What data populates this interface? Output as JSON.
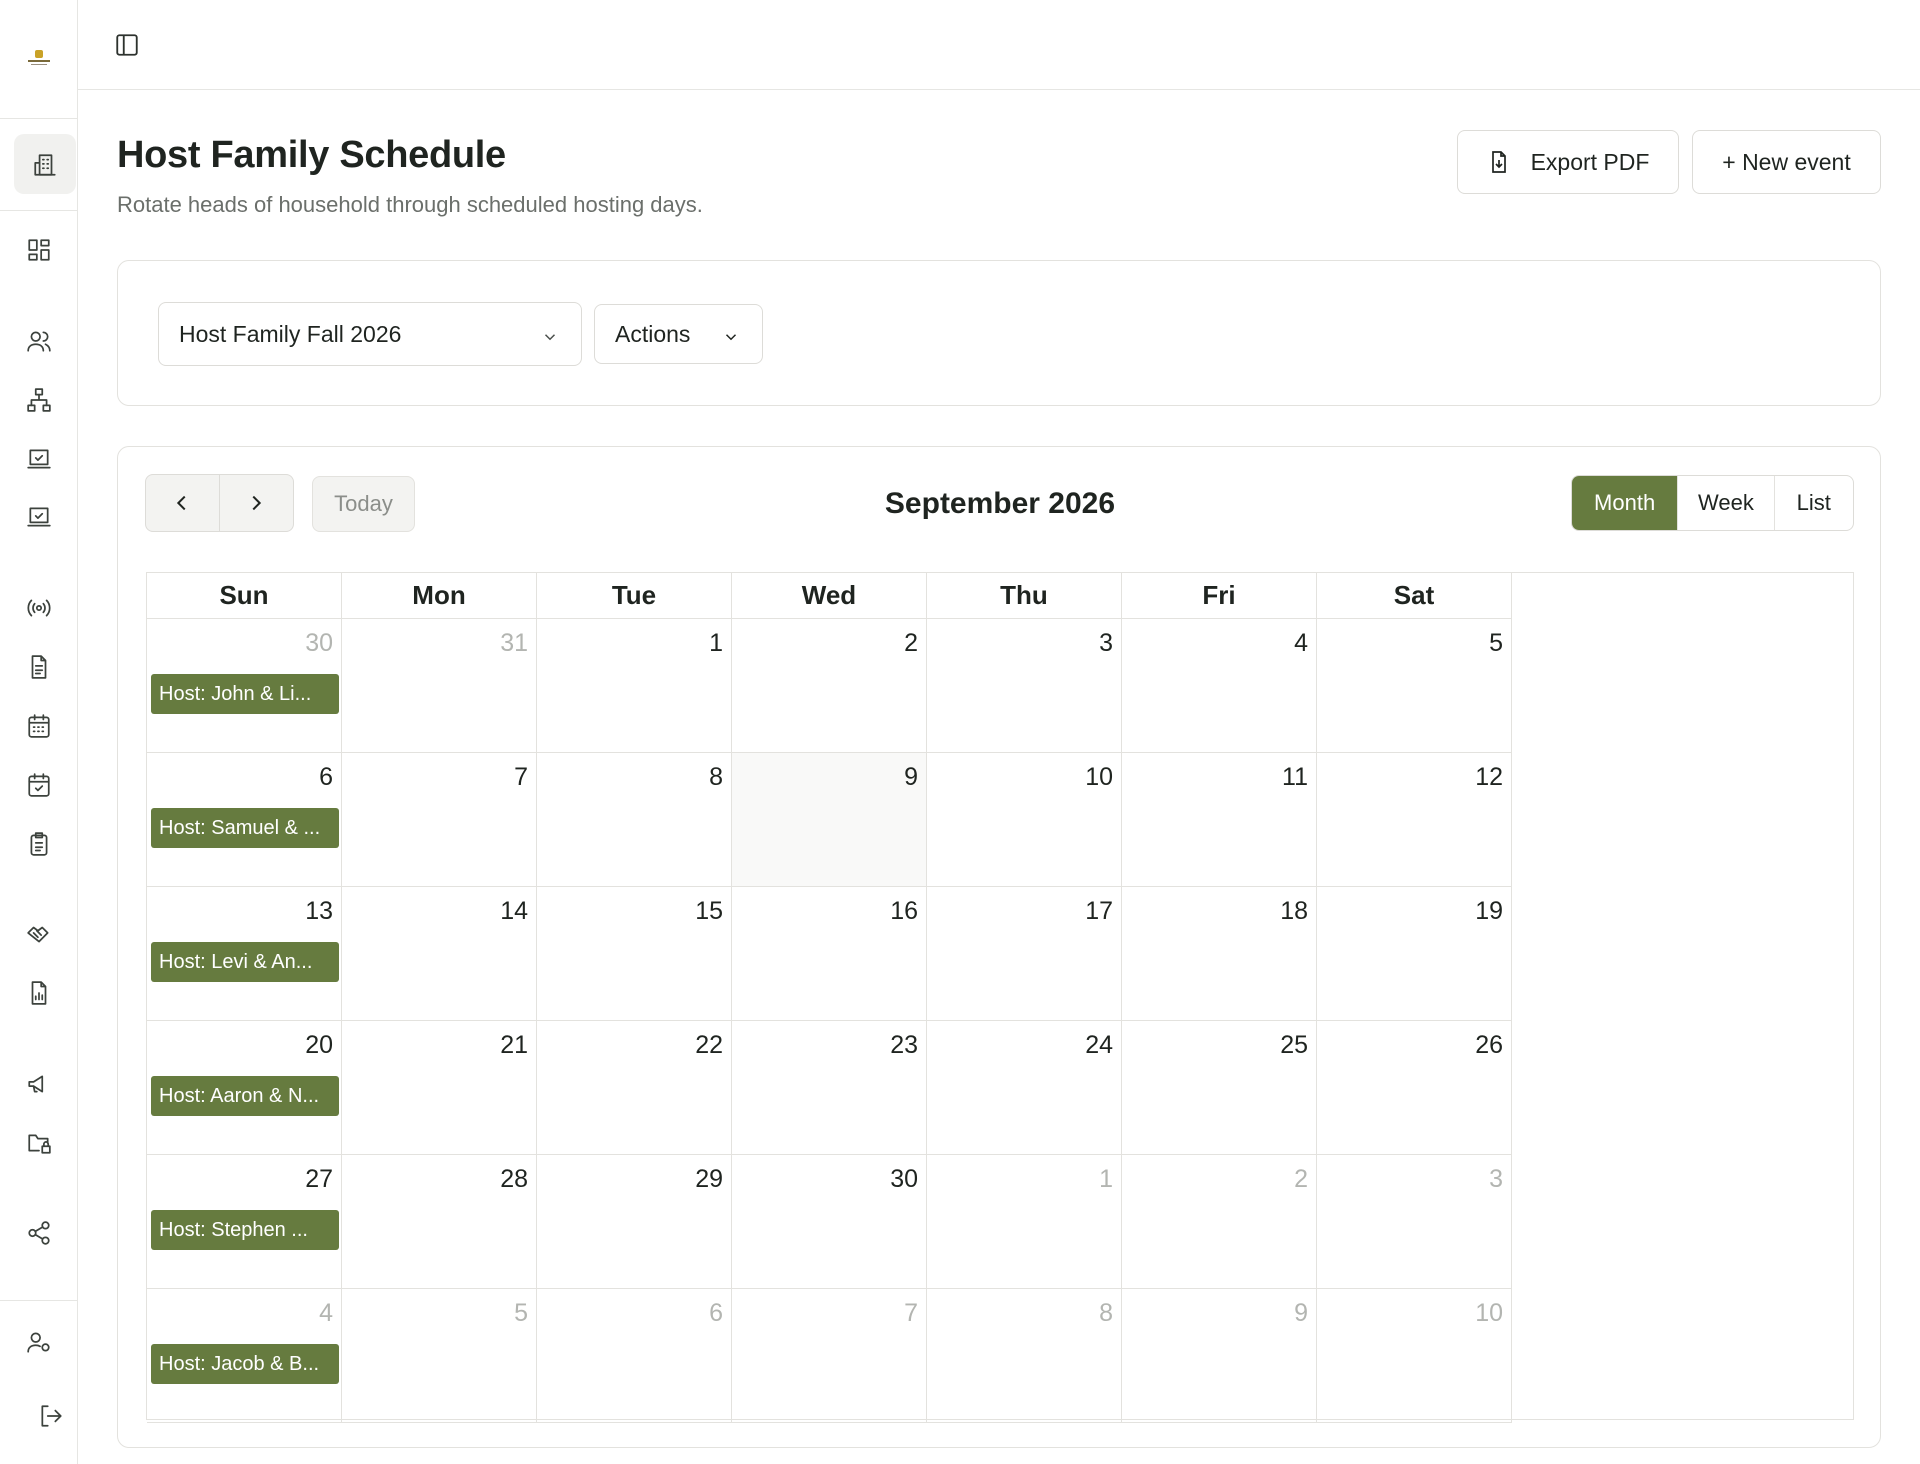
{
  "sidebar": {
    "icons": [
      "building-icon",
      "dashboard-icon",
      "users-icon",
      "org-chart-icon",
      "checkbox-icon",
      "checkbox-icon",
      "broadcast-icon",
      "document-icon",
      "calendar-icon",
      "calendar-check-icon",
      "clipboard-icon",
      "handshake-icon",
      "report-icon",
      "megaphone-icon",
      "folder-lock-icon",
      "share-icon",
      "user-settings-icon",
      "logout-icon"
    ]
  },
  "header": {
    "title": "Host Family Schedule",
    "subtitle": "Rotate heads of household through scheduled hosting days.",
    "export_label": "Export PDF",
    "new_event_label": "+ New event"
  },
  "filters": {
    "schedule_select": "Host Family Fall 2026",
    "actions_label": "Actions"
  },
  "calendar": {
    "title": "September 2026",
    "today_label": "Today",
    "views": [
      {
        "label": "Month",
        "active": true
      },
      {
        "label": "Week",
        "active": false
      },
      {
        "label": "List",
        "active": false
      }
    ],
    "days_of_week": [
      "Sun",
      "Mon",
      "Tue",
      "Wed",
      "Thu",
      "Fri",
      "Sat"
    ],
    "weeks": [
      [
        {
          "num": "30",
          "other": true,
          "event": "Host: John & Li..."
        },
        {
          "num": "31",
          "other": true
        },
        {
          "num": "1"
        },
        {
          "num": "2"
        },
        {
          "num": "3"
        },
        {
          "num": "4"
        },
        {
          "num": "5"
        }
      ],
      [
        {
          "num": "6",
          "event": "Host: Samuel & ..."
        },
        {
          "num": "7"
        },
        {
          "num": "8"
        },
        {
          "num": "9",
          "today": true
        },
        {
          "num": "10"
        },
        {
          "num": "11"
        },
        {
          "num": "12"
        }
      ],
      [
        {
          "num": "13",
          "event": "Host: Levi & An..."
        },
        {
          "num": "14"
        },
        {
          "num": "15"
        },
        {
          "num": "16"
        },
        {
          "num": "17"
        },
        {
          "num": "18"
        },
        {
          "num": "19"
        }
      ],
      [
        {
          "num": "20",
          "event": "Host: Aaron & N..."
        },
        {
          "num": "21"
        },
        {
          "num": "22"
        },
        {
          "num": "23"
        },
        {
          "num": "24"
        },
        {
          "num": "25"
        },
        {
          "num": "26"
        }
      ],
      [
        {
          "num": "27",
          "event": "Host: Stephen ..."
        },
        {
          "num": "28"
        },
        {
          "num": "29"
        },
        {
          "num": "30"
        },
        {
          "num": "1",
          "other": true
        },
        {
          "num": "2",
          "other": true
        },
        {
          "num": "3",
          "other": true
        }
      ],
      [
        {
          "num": "4",
          "other": true,
          "event": "Host: Jacob & B..."
        },
        {
          "num": "5",
          "other": true
        },
        {
          "num": "6",
          "other": true
        },
        {
          "num": "7",
          "other": true
        },
        {
          "num": "8",
          "other": true
        },
        {
          "num": "9",
          "other": true
        },
        {
          "num": "10",
          "other": true
        }
      ]
    ]
  },
  "colors": {
    "accent": "#667b3f",
    "border": "#e3e2de",
    "muted_text": "#6b6f6b"
  }
}
